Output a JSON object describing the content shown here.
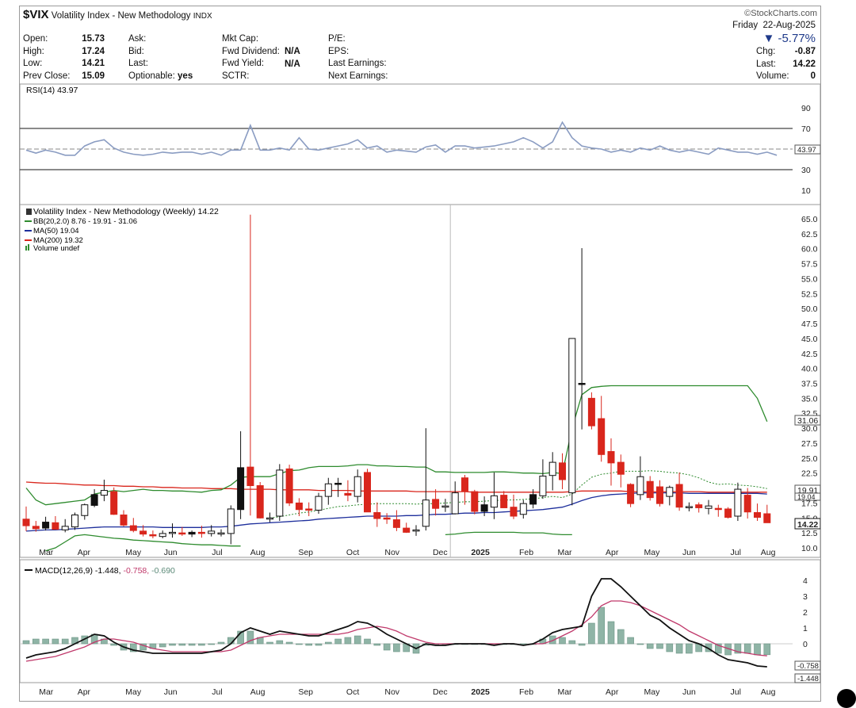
{
  "header": {
    "symbol": "$VIX",
    "name": "Volatility Index - New Methodology",
    "exchange": "INDX",
    "brand": "©StockCharts.com",
    "day": "Friday",
    "date": "22-Aug-2025",
    "change_pct": "-5.77%",
    "quote": {
      "open_label": "Open:",
      "open": "15.73",
      "high_label": "High:",
      "high": "17.24",
      "low_label": "Low:",
      "low": "14.21",
      "prev_label": "Prev Close:",
      "prev": "15.09",
      "ask_label": "Ask:",
      "bid_label": "Bid:",
      "last_label": "Last:",
      "optionable_label": "Optionable:",
      "optionable": "yes",
      "mktcap_label": "Mkt Cap:",
      "fwddiv_label": "Fwd Dividend:",
      "fwddiv": "N/A",
      "fwdyield_label": "Fwd Yield:",
      "fwdyield": "N/A",
      "sctr_label": "SCTR:",
      "pe_label": "P/E:",
      "eps_label": "EPS:",
      "lastearn_label": "Last Earnings:",
      "nextearn_label": "Next Earnings:",
      "chg_label": "Chg:",
      "chg": "-0.87",
      "last2_label": "Last:",
      "last2": "14.22",
      "volume_label": "Volume:",
      "volume": "0"
    }
  },
  "rsi_panel": {
    "label": "RSI(14) 43.97",
    "last_tag": "43.97"
  },
  "price_panel": {
    "title": "Volatility Index - New Methodology (Weekly) 14.22",
    "legend_bb": "BB(20,2.0) 8.76 - 19.91 - 31.06",
    "legend_ma50": "MA(50) 19.04",
    "legend_ma200": "MA(200) 19.32",
    "legend_vol": "Volume undef",
    "tag_upper": "31.06",
    "tag_mid": "19.91",
    "tag_ma50": "19.04",
    "tag_last": "14.22"
  },
  "macd_panel": {
    "label_main": "MACD(12,26,9) -1.448,",
    "label_signal": "-0.758,",
    "label_hist": "-0.690",
    "tag_signal": "-0.758",
    "tag_macd": "-1.448"
  },
  "colors": {
    "up": "#ffffff",
    "down": "#d9261c",
    "bb": "#2e8b2e",
    "ma50": "#1e2f9c",
    "ma200": "#d9261c",
    "macd": "#111111",
    "signal": "#c0396b",
    "hist": "#8fb4a6",
    "rsi": "#8a9cc2"
  },
  "chart_data": [
    {
      "type": "line",
      "name": "RSI(14)",
      "ylim": [
        0,
        100
      ],
      "y_ticks": [
        10,
        30,
        50,
        70,
        90
      ],
      "reference_lines": [
        30,
        50,
        70
      ],
      "values": [
        49,
        46,
        49,
        47,
        44,
        44,
        53,
        57,
        59,
        51,
        47,
        45,
        44,
        45,
        47,
        46,
        47,
        47,
        45,
        47,
        44,
        49,
        49,
        73,
        49,
        49,
        51,
        49,
        61,
        50,
        49,
        51,
        53,
        55,
        59,
        51,
        53,
        47,
        49,
        48,
        47,
        52,
        54,
        47,
        53,
        53,
        51,
        52,
        53,
        55,
        57,
        61,
        57,
        51,
        57,
        76,
        61,
        53,
        51,
        50,
        47,
        49,
        47,
        51,
        49,
        53,
        49,
        47,
        49,
        47,
        45,
        51,
        49,
        47,
        47,
        45,
        47,
        44
      ]
    },
    {
      "type": "candlestick",
      "name": "Volatility Index - New Methodology (Weekly)",
      "ylim": [
        10,
        65
      ],
      "y_ticks": [
        10,
        12.5,
        15,
        17.5,
        20,
        22.5,
        25,
        27.5,
        30,
        32.5,
        35,
        37.5,
        40,
        42.5,
        45,
        47.5,
        50,
        52.5,
        55,
        57.5,
        60,
        62.5,
        65
      ],
      "x_labels": [
        "Mar",
        "Apr",
        "May",
        "Jun",
        "Jul",
        "Aug",
        "Sep",
        "Oct",
        "Nov",
        "Dec",
        "2025",
        "Feb",
        "Mar",
        "Apr",
        "May",
        "Jun",
        "Jul",
        "Aug"
      ],
      "ohlc": [
        [
          14.8,
          16.9,
          12.8,
          13.7
        ],
        [
          13.6,
          14.5,
          12.7,
          13.2
        ],
        [
          13.3,
          15.2,
          12.9,
          14.3
        ],
        [
          14.2,
          15.3,
          13.4,
          13.1
        ],
        [
          13.0,
          14.8,
          12.6,
          13.6
        ],
        [
          13.5,
          15.9,
          13.0,
          15.5
        ],
        [
          15.4,
          17.4,
          14.7,
          17.2
        ],
        [
          17.1,
          19.8,
          16.8,
          18.9
        ],
        [
          18.8,
          21.4,
          17.8,
          19.6
        ],
        [
          19.4,
          20.1,
          15.5,
          15.6
        ],
        [
          15.5,
          16.3,
          13.6,
          13.8
        ],
        [
          13.7,
          15.0,
          12.6,
          12.9
        ],
        [
          12.8,
          13.8,
          11.9,
          12.3
        ],
        [
          12.2,
          12.9,
          11.6,
          12.0
        ],
        [
          11.9,
          12.9,
          11.6,
          12.4
        ],
        [
          12.5,
          14.1,
          11.7,
          12.6
        ],
        [
          12.5,
          13.5,
          12.0,
          12.4
        ],
        [
          12.3,
          12.9,
          11.8,
          12.6
        ],
        [
          12.6,
          13.7,
          11.7,
          12.5
        ],
        [
          12.4,
          13.8,
          11.9,
          12.8
        ],
        [
          12.3,
          13.1,
          11.9,
          12.5
        ],
        [
          12.4,
          17.1,
          10.6,
          16.5
        ],
        [
          16.4,
          29.5,
          14.8,
          23.4
        ],
        [
          23.5,
          65.7,
          15.4,
          20.4
        ],
        [
          20.4,
          21.0,
          14.9,
          15.0
        ],
        [
          15.0,
          15.9,
          14.3,
          15.0
        ],
        [
          15.3,
          24.0,
          14.5,
          23.0
        ],
        [
          23.2,
          23.9,
          17.0,
          17.5
        ],
        [
          17.5,
          18.3,
          15.3,
          16.4
        ],
        [
          16.5,
          17.6,
          15.3,
          16.3
        ],
        [
          16.3,
          19.2,
          15.7,
          18.6
        ],
        [
          18.6,
          21.7,
          17.2,
          20.7
        ],
        [
          20.7,
          21.7,
          18.5,
          20.8
        ],
        [
          19.1,
          21.3,
          17.8,
          18.8
        ],
        [
          18.6,
          23.1,
          17.6,
          21.9
        ],
        [
          22.6,
          23.2,
          16.1,
          16.0
        ],
        [
          15.9,
          17.6,
          13.5,
          14.9
        ],
        [
          15.0,
          15.8,
          14.0,
          14.8
        ],
        [
          14.7,
          16.3,
          12.8,
          13.4
        ],
        [
          13.3,
          14.2,
          12.5,
          12.6
        ],
        [
          12.8,
          13.8,
          12.0,
          13.0
        ],
        [
          13.6,
          30.0,
          12.9,
          18.0
        ],
        [
          18.1,
          19.8,
          15.4,
          16.6
        ],
        [
          16.8,
          18.2,
          16.0,
          17.0
        ],
        [
          15.7,
          21.1,
          15.6,
          19.2
        ],
        [
          21.7,
          22.2,
          17.2,
          19.5
        ],
        [
          19.4,
          19.7,
          15.6,
          16.1
        ],
        [
          16.1,
          18.6,
          15.3,
          17.2
        ],
        [
          16.8,
          22.6,
          14.8,
          18.7
        ],
        [
          18.8,
          19.5,
          16.7,
          16.7
        ],
        [
          16.8,
          18.9,
          14.8,
          15.3
        ],
        [
          15.6,
          18.0,
          14.9,
          17.4
        ],
        [
          17.3,
          19.8,
          16.6,
          18.9
        ],
        [
          18.7,
          24.8,
          18.2,
          22.0
        ],
        [
          22.1,
          26.0,
          19.6,
          24.3
        ],
        [
          24.2,
          25.8,
          19.8,
          21.4
        ],
        [
          19.2,
          45.0,
          17.1,
          45.0
        ],
        [
          37.5,
          60.1,
          29.8,
          37.5
        ],
        [
          35.0,
          36.0,
          29.8,
          30.4
        ],
        [
          31.6,
          35.4,
          24.4,
          25.6
        ],
        [
          26.1,
          28.3,
          20.4,
          24.2
        ],
        [
          24.3,
          25.6,
          20.1,
          22.3
        ],
        [
          20.6,
          20.8,
          16.8,
          17.4
        ],
        [
          18.9,
          25.3,
          18.0,
          21.9
        ],
        [
          21.1,
          22.0,
          17.9,
          18.4
        ],
        [
          20.2,
          21.3,
          16.9,
          17.4
        ],
        [
          18.6,
          20.4,
          17.1,
          20.1
        ],
        [
          20.6,
          22.6,
          16.2,
          16.8
        ],
        [
          16.8,
          17.6,
          16.1,
          16.9
        ],
        [
          17.2,
          17.6,
          15.9,
          16.7
        ],
        [
          16.6,
          18.0,
          15.6,
          17.0
        ],
        [
          16.6,
          17.2,
          15.2,
          16.5
        ],
        [
          16.5,
          16.8,
          14.9,
          15.1
        ],
        [
          15.3,
          20.9,
          14.5,
          19.8
        ],
        [
          18.8,
          20.0,
          14.9,
          16.0
        ],
        [
          15.9,
          17.4,
          14.5,
          15.1
        ],
        [
          15.7,
          17.2,
          14.2,
          14.2
        ]
      ],
      "bb_upper": [
        20.0,
        18.0,
        17.2,
        17.4,
        17.6,
        17.8,
        18.0,
        19.0,
        19.3,
        19.6,
        19.4,
        19.6,
        19.8,
        19.6,
        19.6,
        19.5,
        19.5,
        19.4,
        19.3,
        19.6,
        19.7,
        20.5,
        21.8,
        21.9,
        21.9,
        21.9,
        22.4,
        22.9,
        23.0,
        23.4,
        23.6,
        23.6,
        23.6,
        23.7,
        23.9,
        23.9,
        23.7,
        23.7,
        23.6,
        23.6,
        23.5,
        23.5,
        22.7,
        22.7,
        22.6,
        22.6,
        22.6,
        22.6,
        22.7,
        22.7,
        22.6,
        22.5,
        22.5,
        22.4,
        22.6,
        22.4,
        30.0,
        35.6,
        36.8,
        37.0,
        37.1,
        37.1,
        37.1,
        37.1,
        37.1,
        37.1,
        37.1,
        37.1,
        37.1,
        37.1,
        37.1,
        37.1,
        37.1,
        37.1,
        37.1,
        35.0,
        31.1
      ],
      "bb_middle": [
        null,
        null,
        null,
        null,
        null,
        null,
        null,
        null,
        null,
        null,
        null,
        null,
        null,
        null,
        null,
        null,
        null,
        null,
        null,
        null,
        null,
        null,
        null,
        null,
        null,
        15.0,
        15.2,
        15.5,
        15.8,
        16.0,
        16.3,
        16.6,
        16.9,
        17.0,
        17.2,
        17.3,
        17.4,
        17.4,
        17.4,
        17.4,
        17.3,
        17.4,
        17.4,
        17.5,
        17.6,
        17.7,
        17.7,
        17.8,
        17.9,
        18.0,
        18.0,
        18.1,
        18.2,
        18.4,
        18.6,
        18.4,
        19.0,
        20.5,
        21.8,
        22.3,
        22.5,
        22.8,
        22.8,
        22.8,
        22.9,
        22.8,
        22.6,
        22.5,
        22.2,
        21.7,
        21.0,
        20.6,
        20.7,
        20.5,
        20.4,
        20.2,
        19.9
      ],
      "bb_lower": [
        null,
        null,
        9.5,
        10.0,
        11.0,
        12.0,
        12.2,
        12.0,
        11.8,
        11.6,
        11.5,
        11.3,
        11.2,
        11.1,
        11.0,
        10.9,
        10.7,
        10.6,
        10.5,
        10.5,
        10.4,
        10.3,
        10.3,
        null,
        null,
        null,
        null,
        null,
        null,
        null,
        null,
        null,
        null,
        null,
        null,
        null,
        null,
        null,
        null,
        null,
        null,
        null,
        null,
        12.2,
        12.3,
        12.5,
        12.6,
        12.6,
        12.6,
        12.6,
        12.6,
        12.5,
        12.5,
        12.5,
        12.3,
        12.2,
        12.2,
        null,
        null,
        null,
        null,
        null,
        null,
        null,
        null,
        null,
        null,
        null,
        null,
        null,
        null,
        null,
        null,
        null,
        null,
        null,
        null
      ],
      "ma200": [
        21.0,
        20.9,
        20.8,
        20.8,
        20.7,
        20.6,
        20.5,
        20.5,
        20.4,
        20.4,
        20.3,
        20.3,
        20.2,
        20.2,
        20.1,
        20.1,
        20.0,
        20.0,
        20.0,
        19.9,
        19.9,
        19.9,
        19.8,
        19.8,
        19.8,
        19.8,
        19.7,
        19.7,
        19.7,
        19.7,
        19.6,
        19.6,
        19.6,
        19.6,
        19.5,
        19.5,
        19.5,
        19.5,
        19.5,
        19.5,
        19.4,
        19.4,
        19.4,
        19.4,
        19.4,
        19.4,
        19.3,
        19.3,
        19.3,
        19.3,
        19.3,
        19.3,
        19.3,
        19.3,
        19.3,
        19.3,
        19.4,
        19.5,
        19.5,
        19.5,
        19.5,
        19.5,
        19.4,
        19.4,
        19.4,
        19.4,
        19.4,
        19.4,
        19.4,
        19.4,
        19.3,
        19.3,
        19.3,
        19.3,
        19.3,
        19.3,
        19.3
      ],
      "ma50": [
        12.8,
        12.9,
        13.0,
        13.0,
        13.1,
        13.2,
        13.3,
        13.4,
        13.5,
        13.5,
        13.5,
        13.5,
        13.5,
        13.5,
        13.4,
        13.4,
        13.4,
        13.4,
        13.4,
        13.5,
        13.5,
        13.6,
        13.8,
        14.0,
        14.1,
        14.2,
        14.3,
        14.4,
        14.5,
        14.6,
        14.8,
        14.9,
        15.0,
        15.1,
        15.2,
        15.3,
        15.3,
        15.3,
        15.3,
        15.4,
        15.4,
        15.5,
        15.6,
        15.6,
        15.7,
        15.8,
        15.8,
        15.9,
        15.9,
        16.0,
        16.1,
        16.2,
        16.3,
        16.4,
        16.6,
        16.8,
        17.3,
        17.9,
        18.4,
        18.7,
        18.9,
        19.0,
        19.1,
        19.2,
        19.2,
        19.2,
        19.2,
        19.2,
        19.1,
        19.1,
        19.1,
        19.1,
        19.1,
        19.1,
        19.1,
        19.1,
        19.0
      ]
    },
    {
      "type": "line",
      "name": "MACD(12,26,9)",
      "ylim": [
        -2.2,
        4.6
      ],
      "y_ticks": [
        0,
        1,
        2,
        3,
        4
      ],
      "x_labels": [
        "Mar",
        "Apr",
        "May",
        "Jun",
        "Jul",
        "Aug",
        "Sep",
        "Oct",
        "Nov",
        "Dec",
        "2025",
        "Feb",
        "Mar",
        "Apr",
        "May",
        "Jun",
        "Jul",
        "Aug"
      ],
      "macd": [
        -0.9,
        -0.7,
        -0.6,
        -0.5,
        -0.3,
        0.0,
        0.3,
        0.6,
        0.5,
        0.1,
        -0.2,
        -0.4,
        -0.5,
        -0.6,
        -0.6,
        -0.6,
        -0.6,
        -0.6,
        -0.6,
        -0.5,
        -0.4,
        0.0,
        0.7,
        1.0,
        0.8,
        0.6,
        0.8,
        0.7,
        0.6,
        0.5,
        0.5,
        0.7,
        0.9,
        1.1,
        1.4,
        1.3,
        1.0,
        0.6,
        0.3,
        0.0,
        -0.3,
        0.0,
        -0.1,
        -0.1,
        0.0,
        0.0,
        0.0,
        0.0,
        -0.1,
        0.0,
        0.0,
        -0.1,
        0.0,
        0.3,
        0.7,
        0.9,
        1.0,
        1.1,
        3.0,
        4.1,
        4.1,
        3.6,
        3.0,
        2.4,
        1.8,
        1.5,
        1.0,
        0.6,
        0.2,
        0.0,
        -0.3,
        -0.7,
        -1.0,
        -1.1,
        -1.2,
        -1.4,
        -1.448
      ],
      "signal": [
        -1.1,
        -1.0,
        -0.9,
        -0.8,
        -0.6,
        -0.4,
        -0.2,
        0.1,
        0.3,
        0.3,
        0.2,
        0.1,
        -0.1,
        -0.3,
        -0.4,
        -0.5,
        -0.5,
        -0.5,
        -0.5,
        -0.5,
        -0.5,
        -0.4,
        -0.1,
        0.2,
        0.4,
        0.5,
        0.6,
        0.6,
        0.6,
        0.6,
        0.6,
        0.6,
        0.6,
        0.7,
        0.9,
        1.0,
        1.1,
        1.0,
        0.8,
        0.5,
        0.3,
        0.1,
        0.0,
        0.0,
        0.0,
        0.0,
        0.0,
        0.0,
        0.0,
        0.0,
        0.0,
        -0.1,
        0.0,
        0.0,
        0.2,
        0.5,
        0.8,
        1.2,
        1.7,
        2.4,
        2.7,
        2.7,
        2.6,
        2.4,
        2.1,
        1.8,
        1.5,
        1.2,
        0.8,
        0.5,
        0.2,
        -0.1,
        -0.3,
        -0.5,
        -0.6,
        -0.7,
        -0.758
      ],
      "histogram": [
        0.2,
        0.3,
        0.3,
        0.3,
        0.3,
        0.4,
        0.5,
        0.6,
        0.3,
        -0.1,
        -0.4,
        -0.5,
        -0.4,
        -0.3,
        -0.2,
        -0.1,
        -0.1,
        -0.1,
        -0.1,
        0.0,
        0.1,
        0.4,
        0.8,
        0.8,
        0.4,
        0.1,
        0.2,
        0.1,
        0.0,
        -0.1,
        -0.1,
        0.1,
        0.3,
        0.4,
        0.5,
        0.3,
        -0.1,
        -0.4,
        -0.5,
        -0.5,
        -0.6,
        -0.1,
        -0.1,
        -0.1,
        0.0,
        0.0,
        0.0,
        0.0,
        -0.1,
        0.0,
        0.0,
        0.0,
        0.0,
        0.3,
        0.5,
        0.4,
        0.2,
        -0.1,
        1.3,
        2.3,
        1.4,
        0.9,
        0.4,
        0.0,
        -0.3,
        -0.3,
        -0.5,
        -0.6,
        -0.6,
        -0.5,
        -0.5,
        -0.6,
        -0.7,
        -0.6,
        -0.6,
        -0.7,
        -0.69
      ]
    }
  ]
}
